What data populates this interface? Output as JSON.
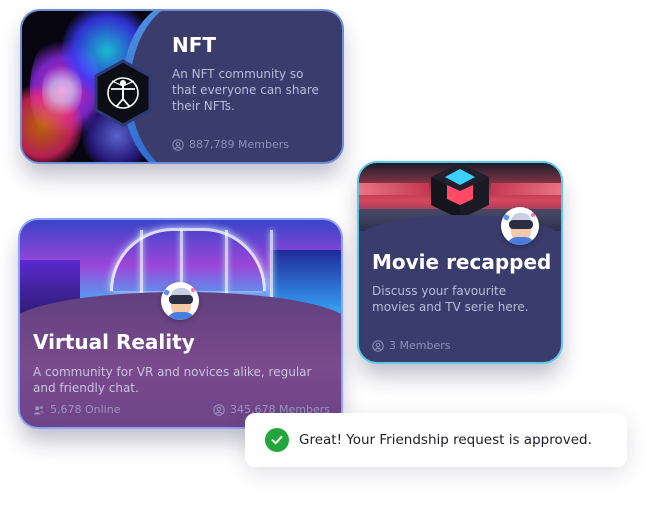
{
  "cards": {
    "nft": {
      "title": "NFT",
      "description": "An NFT community so that everyone can share their NFTs.",
      "members": "887,789 Members",
      "badge_icon": "vitruvian-man-hexagon-icon"
    },
    "movie": {
      "title": "Movie recapped",
      "description": "Discuss your favourite movies and TV serie here.",
      "members": "3 Members"
    },
    "vr": {
      "title": "Virtual Reality",
      "description": "A community for VR and novices alike, regular and friendly chat.",
      "online": "5,678 Online",
      "members": "345,678 Members"
    }
  },
  "toast": {
    "message": "Great! Your Friendship request is approved.",
    "icon": "check-circle-icon",
    "color": "#22a53a"
  },
  "colors": {
    "card_bg": "#3a3c6c",
    "nft_border": "#6e8fd6",
    "movie_border": "#5bc8f0",
    "vr_border": "#8aa3ff"
  }
}
